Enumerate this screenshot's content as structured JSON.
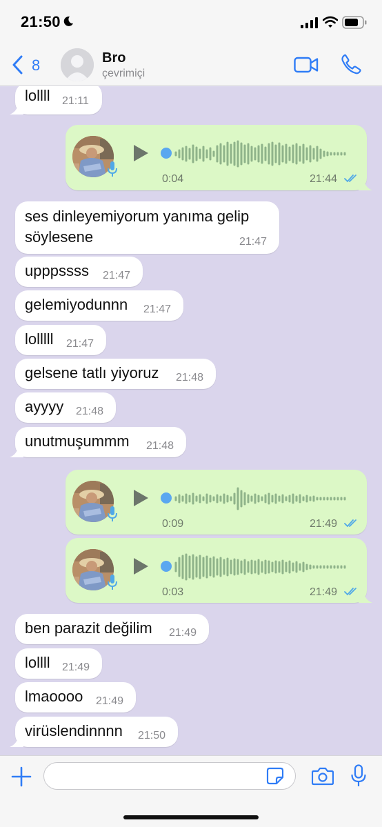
{
  "status_bar": {
    "time": "21:50",
    "icons": [
      "moon-icon",
      "cellular-signal-icon",
      "wifi-icon",
      "battery-icon"
    ]
  },
  "header": {
    "back_count": "8",
    "contact_name": "Bro",
    "contact_status": "çevrimiçi"
  },
  "messages": [
    {
      "type": "text",
      "dir": "in",
      "text": "lollll",
      "time": "21:11"
    },
    {
      "type": "voice",
      "dir": "out",
      "duration": "0:04",
      "time": "21:44",
      "read": true
    },
    {
      "type": "text",
      "dir": "in",
      "text_line1": "ses dinleyemiyorum yanıma gelip",
      "text_line2": "söylesene",
      "time": "21:47"
    },
    {
      "type": "text",
      "dir": "in",
      "text": "upppssss",
      "time": "21:47"
    },
    {
      "type": "text",
      "dir": "in",
      "text": "gelemiyodunnn",
      "time": "21:47"
    },
    {
      "type": "text",
      "dir": "in",
      "text": "lolllll",
      "time": "21:47"
    },
    {
      "type": "text",
      "dir": "in",
      "text": "gelsene tatlı yiyoruz",
      "time": "21:48"
    },
    {
      "type": "text",
      "dir": "in",
      "text": "ayyyy",
      "time": "21:48"
    },
    {
      "type": "text",
      "dir": "in",
      "text": "unutmuşummm",
      "time": "21:48"
    },
    {
      "type": "voice",
      "dir": "out",
      "duration": "0:09",
      "time": "21:49",
      "read": true
    },
    {
      "type": "voice",
      "dir": "out",
      "duration": "0:03",
      "time": "21:49",
      "read": true
    },
    {
      "type": "text",
      "dir": "in",
      "text": "ben parazit değilim",
      "time": "21:49"
    },
    {
      "type": "text",
      "dir": "in",
      "text": "lollll",
      "time": "21:49"
    },
    {
      "type": "text",
      "dir": "in",
      "text": "lmaoooo",
      "time": "21:49"
    },
    {
      "type": "text",
      "dir": "in",
      "text": "virüslendinnnn",
      "time": "21:50"
    }
  ],
  "input_bar": {
    "placeholder": ""
  },
  "colors": {
    "accent": "#2f7cf6",
    "chat_bg": "#dad5ec",
    "outgoing_bubble": "#dcf8c6",
    "incoming_bubble": "#ffffff",
    "voice_dot": "#5aa7f0",
    "read_ticks": "#4fa8e8"
  }
}
